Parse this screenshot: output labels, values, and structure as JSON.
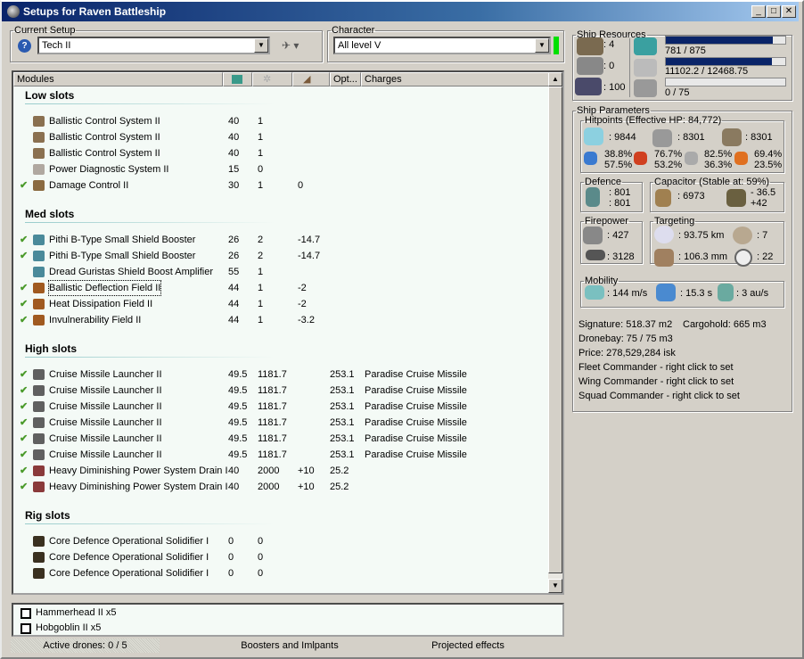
{
  "window": {
    "title": "Setups for Raven Battleship",
    "buttons": [
      "_",
      "□",
      "✕"
    ]
  },
  "current_setup": {
    "label": "Current Setup",
    "value": "Tech II"
  },
  "character": {
    "label": "Character",
    "value": "All level V",
    "status_color": "#00e000"
  },
  "columns": [
    "Modules",
    "cpu-icon",
    "powergrid-icon",
    "capacitor-icon",
    "Opt...",
    "Charges"
  ],
  "sections": [
    {
      "title": "Low slots",
      "items": [
        {
          "active": false,
          "name": "Ballistic Control System II",
          "cpu": "40",
          "pg": "1",
          "cap": "",
          "opt": "",
          "charges": "",
          "icon": "#8a7050"
        },
        {
          "active": false,
          "name": "Ballistic Control System II",
          "cpu": "40",
          "pg": "1",
          "cap": "",
          "opt": "",
          "charges": "",
          "icon": "#8a7050"
        },
        {
          "active": false,
          "name": "Ballistic Control System II",
          "cpu": "40",
          "pg": "1",
          "cap": "",
          "opt": "",
          "charges": "",
          "icon": "#8a7050"
        },
        {
          "active": false,
          "name": "Power Diagnostic System II",
          "cpu": "15",
          "pg": "0",
          "cap": "",
          "opt": "",
          "charges": "",
          "icon": "#b0a8a0"
        },
        {
          "active": true,
          "name": "Damage Control II",
          "cpu": "30",
          "pg": "1",
          "cap": "0",
          "opt": "",
          "charges": "",
          "icon": "#8a6a40"
        }
      ]
    },
    {
      "title": "Med slots",
      "items": [
        {
          "active": true,
          "name": "Pithi B-Type Small Shield Booster",
          "cpu": "26",
          "pg": "2",
          "cap": "-14.7",
          "opt": "",
          "charges": "",
          "icon": "#4a8a9a"
        },
        {
          "active": true,
          "name": "Pithi B-Type Small Shield Booster",
          "cpu": "26",
          "pg": "2",
          "cap": "-14.7",
          "opt": "",
          "charges": "",
          "icon": "#4a8a9a"
        },
        {
          "active": false,
          "name": "Dread Guristas Shield Boost Amplifier",
          "cpu": "55",
          "pg": "1",
          "cap": "",
          "opt": "",
          "charges": "",
          "icon": "#4a8a9a"
        },
        {
          "active": true,
          "name": "Ballistic Deflection Field II",
          "cpu": "44",
          "pg": "1",
          "cap": "-2",
          "opt": "",
          "charges": "",
          "icon": "#a05a20",
          "focused": true
        },
        {
          "active": true,
          "name": "Heat Dissipation Field II",
          "cpu": "44",
          "pg": "1",
          "cap": "-2",
          "opt": "",
          "charges": "",
          "icon": "#a05a20"
        },
        {
          "active": true,
          "name": "Invulnerability Field II",
          "cpu": "44",
          "pg": "1",
          "cap": "-3.2",
          "opt": "",
          "charges": "",
          "icon": "#a05a20"
        }
      ]
    },
    {
      "title": "High slots",
      "items": [
        {
          "active": true,
          "name": "Cruise Missile Launcher II",
          "cpu": "49.5",
          "pg": "1181.7",
          "cap": "",
          "opt": "253.1",
          "charges": "Paradise Cruise Missile",
          "icon": "#606060"
        },
        {
          "active": true,
          "name": "Cruise Missile Launcher II",
          "cpu": "49.5",
          "pg": "1181.7",
          "cap": "",
          "opt": "253.1",
          "charges": "Paradise Cruise Missile",
          "icon": "#606060"
        },
        {
          "active": true,
          "name": "Cruise Missile Launcher II",
          "cpu": "49.5",
          "pg": "1181.7",
          "cap": "",
          "opt": "253.1",
          "charges": "Paradise Cruise Missile",
          "icon": "#606060"
        },
        {
          "active": true,
          "name": "Cruise Missile Launcher II",
          "cpu": "49.5",
          "pg": "1181.7",
          "cap": "",
          "opt": "253.1",
          "charges": "Paradise Cruise Missile",
          "icon": "#606060"
        },
        {
          "active": true,
          "name": "Cruise Missile Launcher II",
          "cpu": "49.5",
          "pg": "1181.7",
          "cap": "",
          "opt": "253.1",
          "charges": "Paradise Cruise Missile",
          "icon": "#606060"
        },
        {
          "active": true,
          "name": "Cruise Missile Launcher II",
          "cpu": "49.5",
          "pg": "1181.7",
          "cap": "",
          "opt": "253.1",
          "charges": "Paradise Cruise Missile",
          "icon": "#606060"
        },
        {
          "active": true,
          "name": "Heavy Diminishing Power System Drain I",
          "cpu": "40",
          "pg": "2000",
          "cap": "+10",
          "opt": "25.2",
          "charges": "",
          "icon": "#8a3a3a"
        },
        {
          "active": true,
          "name": "Heavy Diminishing Power System Drain I",
          "cpu": "40",
          "pg": "2000",
          "cap": "+10",
          "opt": "25.2",
          "charges": "",
          "icon": "#8a3a3a"
        }
      ]
    },
    {
      "title": "Rig slots",
      "items": [
        {
          "active": false,
          "name": "Core Defence Operational Solidifier I",
          "cpu": "0",
          "pg": "0",
          "cap": "",
          "opt": "",
          "charges": "",
          "icon": "#3a3020"
        },
        {
          "active": false,
          "name": "Core Defence Operational Solidifier I",
          "cpu": "0",
          "pg": "0",
          "cap": "",
          "opt": "",
          "charges": "",
          "icon": "#3a3020"
        },
        {
          "active": false,
          "name": "Core Defence Operational Solidifier I",
          "cpu": "0",
          "pg": "0",
          "cap": "",
          "opt": "",
          "charges": "",
          "icon": "#3a3020"
        }
      ]
    }
  ],
  "drones": [
    {
      "name": "Hammerhead II x5",
      "checked": false
    },
    {
      "name": "Hobgoblin II x5",
      "checked": false
    }
  ],
  "bottom_tabs": [
    "Active drones: 0 / 5",
    "Boosters and Imlpants",
    "Projected effects"
  ],
  "resources": {
    "label": "Ship Resources",
    "turrets": ": 4",
    "launchers": ": 0",
    "calibration": ": 100",
    "cpu": {
      "text": "781 / 875",
      "fraction": 0.8926
    },
    "powergrid": {
      "text": "11102.2 / 12468.75",
      "fraction": 0.8904
    },
    "dronebay": {
      "text": "0 / 75",
      "fraction": 0
    }
  },
  "params": {
    "label": "Ship Parameters",
    "hitpoints": {
      "label": "Hitpoints (Effective HP: 84,772)",
      "shield": ": 9844",
      "armor": ": 8301",
      "structure": ": 8301",
      "em": [
        "38.8%",
        "57.5%"
      ],
      "thermal": [
        "76.7%",
        "53.2%"
      ],
      "kinetic": [
        "82.5%",
        "36.3%"
      ],
      "explosive": [
        "69.4%",
        "23.5%"
      ]
    },
    "defence": {
      "label": "Defence",
      "a": ": 801",
      "b": ": 801"
    },
    "capacitor": {
      "label": "Capacitor (Stable at: 59%)",
      "capacity": ": 6973",
      "use": "- 36.5",
      "recharge": "+42"
    },
    "firepower": {
      "label": "Firepower",
      "dps": ": 427",
      "volley": ": 3128"
    },
    "targeting": {
      "label": "Targeting",
      "range": ": 93.75 km",
      "targets": ": 7",
      "scan": ": 106.3 mm",
      "sensor": ": 22"
    },
    "mobility": {
      "label": "Mobility",
      "speed": ": 144 m/s",
      "align": ": 15.3 s",
      "warp": ": 3 au/s"
    },
    "info": [
      "Signature: 518.37 m2",
      "Cargohold: 665 m3",
      "Dronebay: 75 / 75 m3",
      "Price: 278,529,284 isk",
      "Fleet Commander - right click to set",
      "Wing Commander - right click to set",
      "Squad Commander - right click to set"
    ]
  }
}
